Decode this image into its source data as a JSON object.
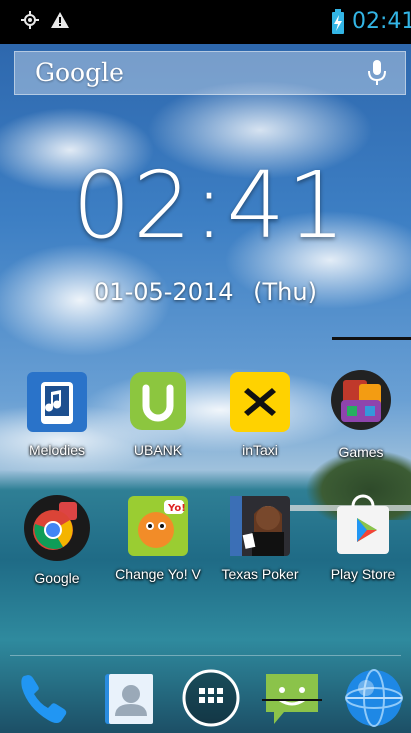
{
  "status_bar": {
    "time": "02:41",
    "icons": [
      "gps-icon",
      "warning-icon",
      "battery-charging-icon"
    ],
    "accent_color": "#33b5e5"
  },
  "search": {
    "logo": "Google",
    "icon": "microphone-icon"
  },
  "clock_widget": {
    "time": "02:41",
    "date": "01-05-2014",
    "day": "(Thu)"
  },
  "apps": [
    {
      "label": "Melodies",
      "icon": "melodies-icon"
    },
    {
      "label": "UBANK",
      "icon": "ubank-icon"
    },
    {
      "label": "inTaxi",
      "icon": "intaxi-icon"
    },
    {
      "label": "Games",
      "icon": "games-icon"
    },
    {
      "label": "Google",
      "icon": "google-folder-icon"
    },
    {
      "label": "Change Yo! V",
      "icon": "change-yo-icon"
    },
    {
      "label": "Texas Poker",
      "icon": "texas-poker-icon"
    },
    {
      "label": "Play Store",
      "icon": "play-store-icon"
    }
  ],
  "dock": [
    {
      "name": "phone-icon"
    },
    {
      "name": "contacts-icon"
    },
    {
      "name": "app-drawer-icon"
    },
    {
      "name": "messaging-icon"
    },
    {
      "name": "browser-icon"
    }
  ]
}
